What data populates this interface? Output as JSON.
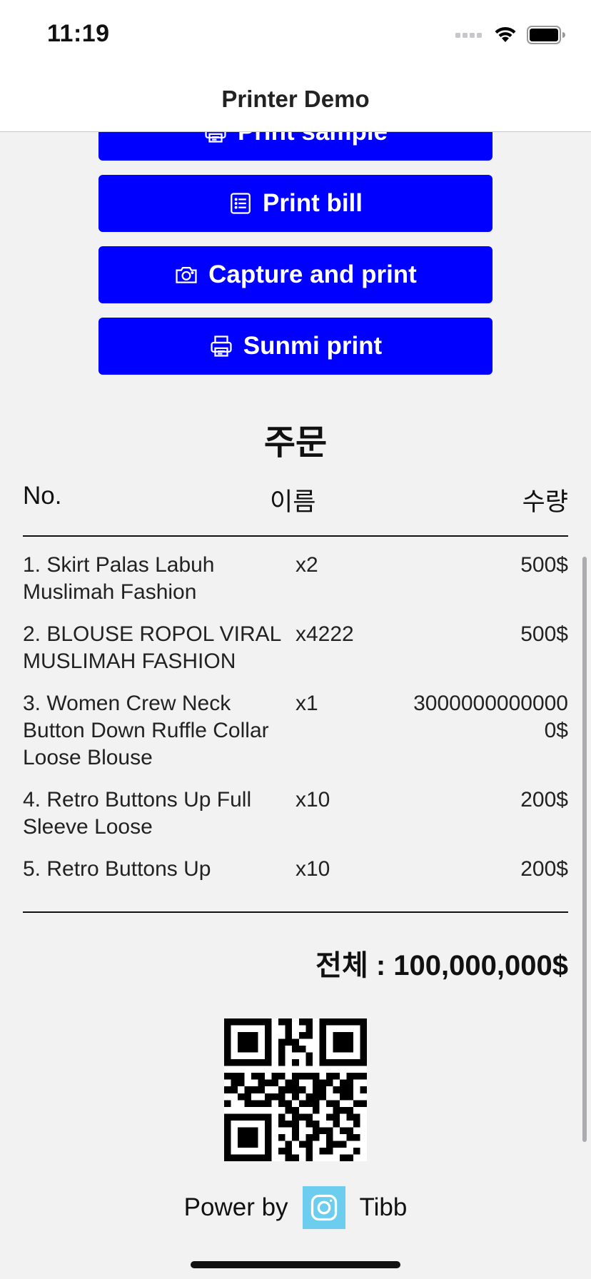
{
  "status_bar": {
    "time": "11:19"
  },
  "nav": {
    "title": "Printer Demo"
  },
  "buttons": [
    {
      "label": "Print sample",
      "icon": "printer-icon"
    },
    {
      "label": "Print bill",
      "icon": "list-icon"
    },
    {
      "label": "Capture and print",
      "icon": "camera-icon"
    },
    {
      "label": "Sunmi print",
      "icon": "printer-icon"
    }
  ],
  "order": {
    "title": "주문",
    "headers": {
      "no": "No.",
      "name": "이름",
      "qty": "수량"
    },
    "items": [
      {
        "name": "1. Skirt Palas Labuh Muslimah Fashion",
        "qty": "x2",
        "price": "500$"
      },
      {
        "name": "2. BLOUSE ROPOL VIRAL MUSLIMAH FASHION",
        "qty": "x4222",
        "price": "500$"
      },
      {
        "name": "3. Women Crew Neck Button Down Ruffle Collar Loose Blouse",
        "qty": "x1",
        "price": "30000000000000$"
      },
      {
        "name": "4. Retro Buttons Up Full Sleeve Loose",
        "qty": "x10",
        "price": "200$"
      },
      {
        "name": "5. Retro Buttons Up",
        "qty": "x10",
        "price": "200$"
      }
    ],
    "total": "전체 : 100,000,000$"
  },
  "footer": {
    "power_by": "Power by",
    "brand": "Tibb",
    "icon": "instagram-icon"
  },
  "colors": {
    "button": "#0000ff",
    "background": "#f2f2f2",
    "instagram_bg": "#6ccdee"
  }
}
